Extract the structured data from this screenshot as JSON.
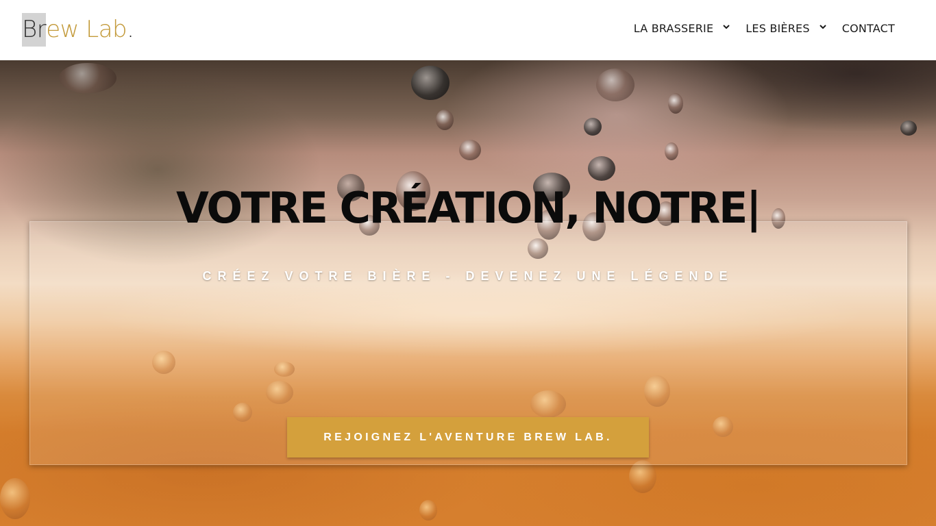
{
  "header": {
    "logo": {
      "part1": "Br",
      "part2": "ew Lab",
      "dot": ".",
      "accent_color": "#c39a3a"
    },
    "nav": [
      {
        "label": "LA BRASSERIE",
        "has_dropdown": true,
        "icon": "chevron-down-icon"
      },
      {
        "label": "LES BIÈRES",
        "has_dropdown": true,
        "icon": "chevron-down-icon"
      },
      {
        "label": "CONTACT",
        "has_dropdown": false
      }
    ]
  },
  "hero": {
    "title": "VOTRE CRÉATION, NOTRE|",
    "subtitle": "CRÉEZ VOTRE BIÈRE - DEVENEZ UNE LÉGENDE",
    "cta_label": "REJOIGNEZ L'AVENTURE BREW LAB.",
    "cta_color": "#d4a03c"
  }
}
